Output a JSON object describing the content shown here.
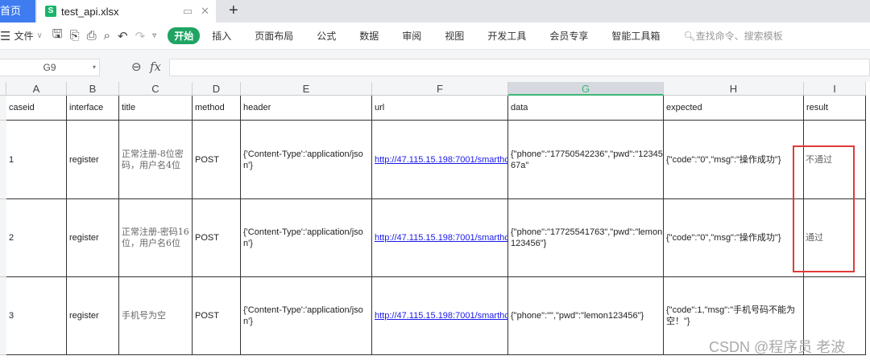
{
  "tabs": {
    "home": "首页",
    "file": "test_api.xlsx",
    "new_tab": "+"
  },
  "toolbar": {
    "file_menu": "文件",
    "start": "开始",
    "menus": [
      "插入",
      "页面布局",
      "公式",
      "数据",
      "审阅",
      "视图",
      "开发工具",
      "会员专享",
      "智能工具箱"
    ],
    "search_placeholder": "查找命令、搜索模板"
  },
  "formula_bar": {
    "cell_ref": "G9",
    "fx": "fx",
    "value": ""
  },
  "columns": [
    "A",
    "B",
    "C",
    "D",
    "E",
    "F",
    "G",
    "H",
    "I"
  ],
  "selected_column": "G",
  "header_row": [
    "caseid",
    "interface",
    "title",
    "method",
    "header",
    "url",
    "data",
    "expected",
    "result"
  ],
  "rows": [
    {
      "caseid": "1",
      "interface": "register",
      "title": "正常注册-8位密码，用户名4位",
      "method": "POST",
      "header": "{'Content-Type':'application/json'}",
      "url": "http://47.115.15.198:7001/smarthc",
      "data": "{\"phone\":\"17750542236\",\"pwd\":\"1234567a\"",
      "expected": "{\"code\":\"0\",\"msg\":\"操作成功\"}",
      "result": "不通过"
    },
    {
      "caseid": "2",
      "interface": "register",
      "title": "正常注册-密码16位，用户名6位",
      "method": "POST",
      "header": "{'Content-Type':'application/json'}",
      "url": "http://47.115.15.198:7001/smarthc",
      "data": "{\"phone\":\"17725541763\",\"pwd\":\"lemon123456\"}",
      "expected": "{\"code\":\"0\",\"msg\":\"操作成功\"}",
      "result": "通过"
    },
    {
      "caseid": "3",
      "interface": "register",
      "title": "手机号为空",
      "method": "POST",
      "header": "{'Content-Type':'application/json'}",
      "url": "http://47.115.15.198:7001/smarthc",
      "data": "{\"phone\":\"\",\"pwd\":\"lemon123456\"}",
      "expected": "{\"code\":1,\"msg\":\"手机号码不能为空！\"}",
      "result": ""
    }
  ],
  "watermark": "CSDN @程序员 老波"
}
